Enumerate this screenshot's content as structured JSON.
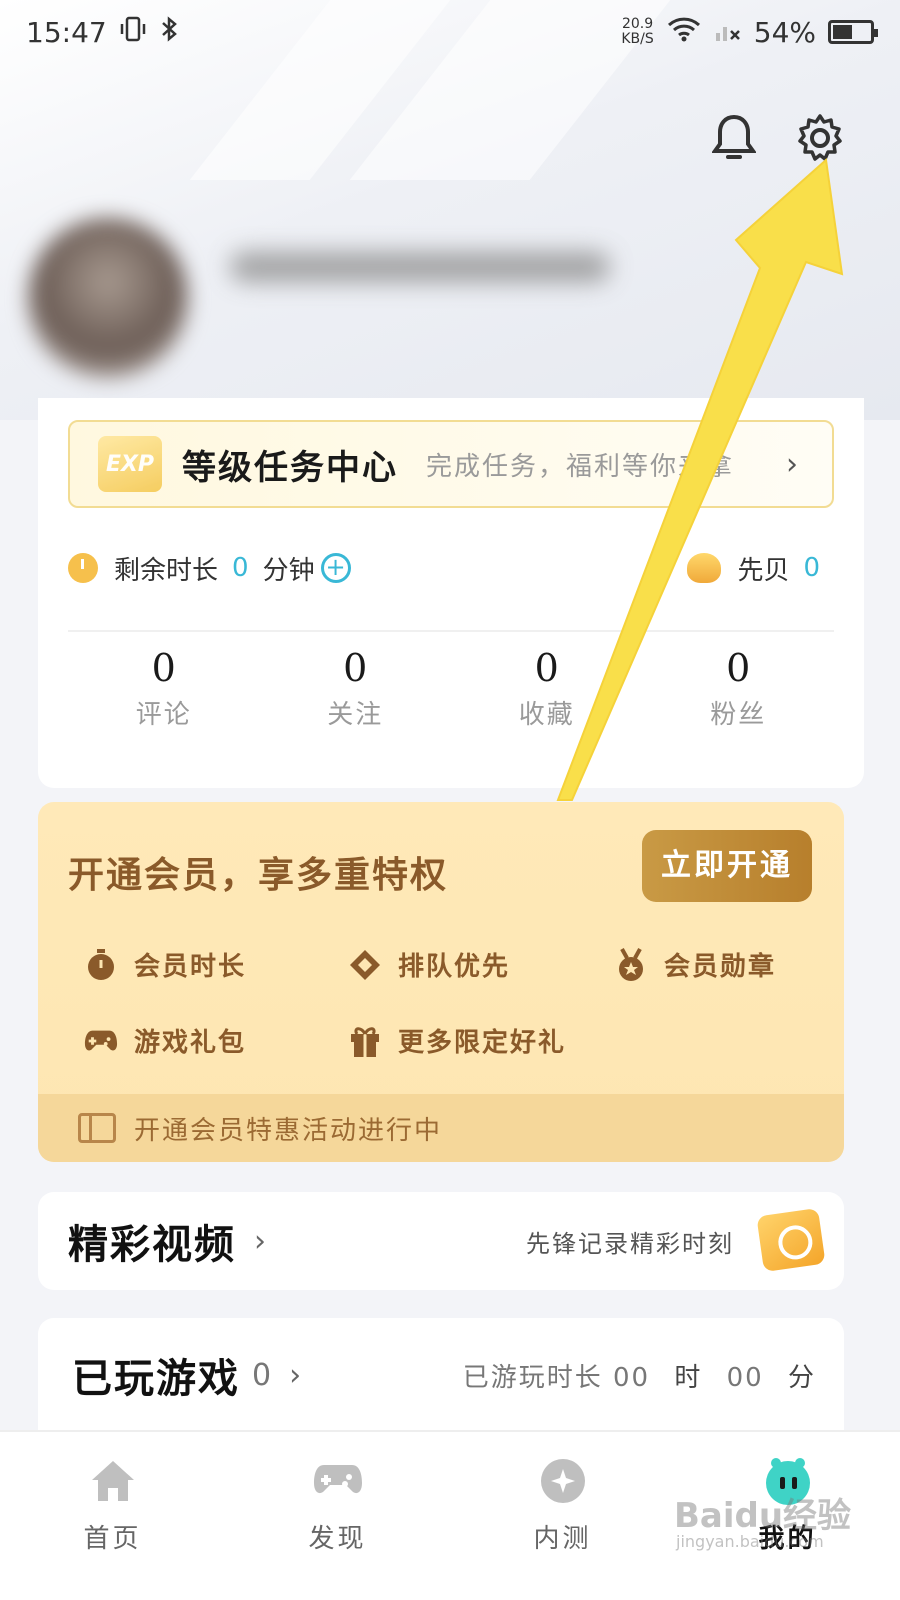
{
  "status_bar": {
    "time": "15:47",
    "net_speed_value": "20.9",
    "net_speed_unit": "KB/S",
    "battery": "54%",
    "battery_level": 0.54
  },
  "level_banner": {
    "badge": "EXP",
    "title": "等级任务中心",
    "subtitle": "完成任务，福利等你来拿"
  },
  "stats": {
    "time_left_label": "剩余时长",
    "time_left_value": "0",
    "time_left_unit": "分钟",
    "shell_label": "先贝",
    "shell_value": "0"
  },
  "counts": [
    {
      "value": "0",
      "label": "评论"
    },
    {
      "value": "0",
      "label": "关注"
    },
    {
      "value": "0",
      "label": "收藏"
    },
    {
      "value": "0",
      "label": "粉丝"
    }
  ],
  "vip": {
    "title": "开通会员，享多重特权",
    "button": "立即开通",
    "perks": [
      "会员时长",
      "排队优先",
      "会员勋章",
      "游戏礼包",
      "更多限定好礼"
    ],
    "footer": "开通会员特惠活动进行中"
  },
  "video": {
    "title": "精彩视频",
    "subtitle": "先锋记录精彩时刻"
  },
  "games": {
    "title": "已玩游戏",
    "count": "0",
    "time_label": "已游玩时长",
    "hours": "00",
    "hours_unit": "时",
    "minutes": "00",
    "minutes_unit": "分"
  },
  "tabs": [
    {
      "label": "首页",
      "icon": "home-icon"
    },
    {
      "label": "发现",
      "icon": "gamepad-icon"
    },
    {
      "label": "内测",
      "icon": "compass-icon"
    },
    {
      "label": "我的",
      "icon": "mascot-icon",
      "active": true
    }
  ],
  "watermark": {
    "text": "Baidu经验",
    "sub": "jingyan.baidu.com"
  },
  "colors": {
    "accent_blue": "#39b8d6",
    "vip_brown": "#8a5a2a",
    "vip_gold": "#c99a45",
    "annotation_yellow": "#f9df4a"
  }
}
